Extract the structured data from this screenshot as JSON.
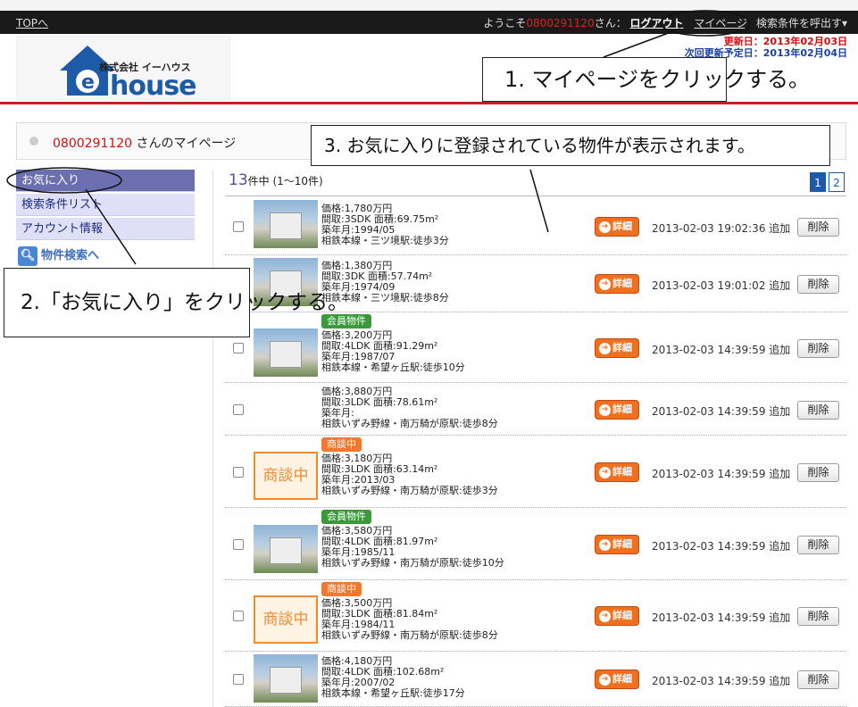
{
  "header": {
    "top_link": "TOPへ",
    "welcome_prefix": "ようこそ",
    "user_number": "0800291120",
    "welcome_suffix": "さん：",
    "logout": "ログアウト",
    "mypage": "マイページ",
    "recall_search": "検索条件を呼出す▾",
    "updated": "更新日：2013年02月03日",
    "next_update": "次回更新予定日：2013年02月04日"
  },
  "logo": {
    "company": "株式会社 イーハウス",
    "wordmark": "house",
    "letter": "e"
  },
  "mypage_bar": {
    "user_number": "0800291120",
    "title_suffix": " さんのマイページ"
  },
  "sidebar": {
    "items": [
      {
        "label": "お気に入り",
        "active": true
      },
      {
        "label": "検索条件リスト",
        "active": false
      },
      {
        "label": "アカウント情報",
        "active": false
      }
    ],
    "search_link": "物件検索へ"
  },
  "list": {
    "count": "13",
    "count_suffix": "件中 (1〜10件)",
    "pages": [
      "1",
      "2"
    ],
    "detail_label": "詳細",
    "delete_label": "削除",
    "rows": [
      {
        "badge": "",
        "thumb": "photo",
        "price": "価格:1,780万円",
        "layout": "間取:3SDK  面積:69.75m²",
        "built": "築年月:1994/05",
        "station": "相鉄本線・三ツ境駅:徒歩3分",
        "date": "2013-02-03 19:02:36 追加"
      },
      {
        "badge": "",
        "thumb": "photo",
        "price": "価格:1,380万円",
        "layout": "間取:3DK  面積:57.74m²",
        "built": "築年月:1974/09",
        "station": "相鉄本線・三ツ境駅:徒歩8分",
        "date": "2013-02-03 19:01:02 追加"
      },
      {
        "badge": "会員物件",
        "thumb": "photo",
        "price": "価格:3,200万円",
        "layout": "間取:4LDK  面積:91.29m²",
        "built": "築年月:1987/07",
        "station": "相鉄本線・希望ヶ丘駅:徒歩10分",
        "date": "2013-02-03 14:39:59 追加"
      },
      {
        "badge": "",
        "thumb": "noimg",
        "price": "価格:3,880万円",
        "layout": "間取:3LDK  面積:78.61m²",
        "built": "築年月:",
        "station": "相鉄いずみ野線・南万騎が原駅:徒歩8分",
        "date": "2013-02-03 14:39:59 追加"
      },
      {
        "badge": "商談中",
        "thumb": "nego",
        "price": "価格:3,180万円",
        "layout": "間取:3LDK  面積:63.14m²",
        "built": "築年月:2013/03",
        "station": "相鉄いずみ野線・南万騎が原駅:徒歩3分",
        "date": "2013-02-03 14:39:59 追加"
      },
      {
        "badge": "会員物件",
        "thumb": "photo",
        "price": "価格:3,580万円",
        "layout": "間取:4LDK  面積:81.97m²",
        "built": "築年月:1985/11",
        "station": "相鉄いずみ野線・南万騎が原駅:徒歩10分",
        "date": "2013-02-03 14:39:59 追加"
      },
      {
        "badge": "商談中",
        "thumb": "nego",
        "price": "価格:3,500万円",
        "layout": "間取:3LDK  面積:81.84m²",
        "built": "築年月:1984/11",
        "station": "相鉄いずみ野線・南万騎が原駅:徒歩8分",
        "date": "2013-02-03 14:39:59 追加"
      },
      {
        "badge": "",
        "thumb": "photo",
        "price": "価格:4,180万円",
        "layout": "間取:4LDK  面積:102.68m²",
        "built": "築年月:2007/02",
        "station": "相鉄本線・希望ヶ丘駅:徒歩17分",
        "date": "2013-02-03 14:39:59 追加"
      }
    ],
    "nego_thumb_label": "商談中"
  },
  "annotations": {
    "step1": "1. マイページをクリックする。",
    "step2": "2.「お気に入り」をクリックする。",
    "step3": "3. お気に入りに登録されている物件が表示されます。"
  }
}
